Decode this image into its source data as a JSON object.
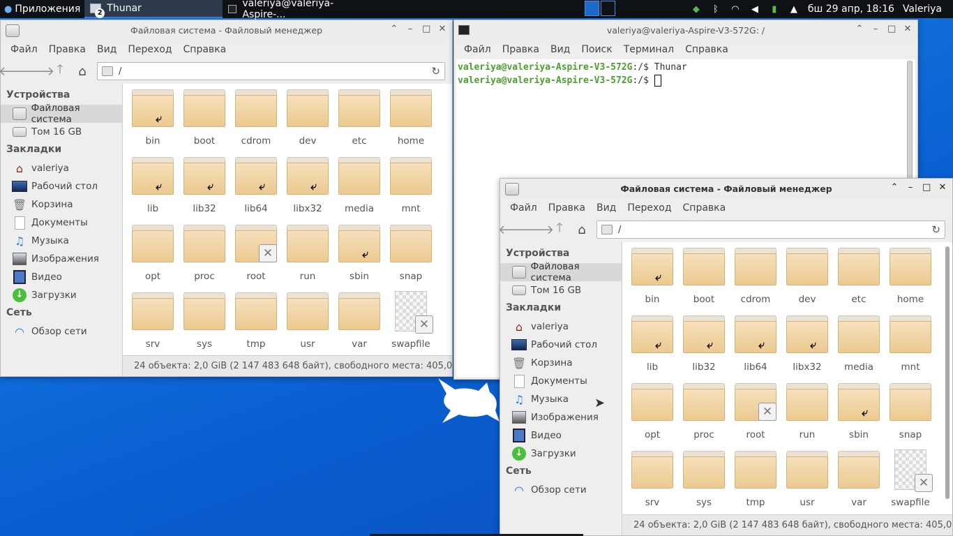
{
  "panel": {
    "apps_label": "Приложения",
    "tasks": [
      {
        "label": "Thunar",
        "badge": "2"
      },
      {
        "label": "valeriya@valeriya-Aspire-..."
      }
    ],
    "clock": "бш 29 апр, 18:16",
    "user": "Valeriya"
  },
  "fm_title": "Файловая система - Файловый менеджер",
  "fm_menu": [
    "Файл",
    "Правка",
    "Вид",
    "Переход",
    "Справка"
  ],
  "location": "/",
  "sidebar": {
    "devices_header": "Устройства",
    "devices": [
      {
        "label": "Файловая система",
        "icon": "disk-icon"
      },
      {
        "label": "Том 16 GB",
        "icon": "drive-icon"
      }
    ],
    "bookmarks_header": "Закладки",
    "bookmarks": [
      {
        "label": "valeriya",
        "icon": "home-icon"
      },
      {
        "label": "Рабочий стол",
        "icon": "desktop-icon"
      },
      {
        "label": "Корзина",
        "icon": "trash-icon"
      },
      {
        "label": "Документы",
        "icon": "document-icon"
      },
      {
        "label": "Музыка",
        "icon": "music-icon"
      },
      {
        "label": "Изображения",
        "icon": "pictures-icon"
      },
      {
        "label": "Видео",
        "icon": "video-icon"
      },
      {
        "label": "Загрузки",
        "icon": "download-icon"
      }
    ],
    "network_header": "Сеть",
    "network": [
      {
        "label": "Обзор сети",
        "icon": "network-icon"
      }
    ]
  },
  "files": [
    "bin",
    "boot",
    "cdrom",
    "dev",
    "etc",
    "home",
    "lib",
    "lib32",
    "lib64",
    "libx32",
    "media",
    "mnt",
    "opt",
    "proc",
    "root",
    "run",
    "sbin",
    "snap",
    "srv",
    "sys",
    "tmp",
    "usr",
    "var",
    "swapfile"
  ],
  "status": "24 объекта: 2,0 GiB (2 147 483 648 байт), свободного места: 405,0 ...",
  "terminal": {
    "title": "valeriya@valeriya-Aspire-V3-572G: /",
    "menu": [
      "Файл",
      "Правка",
      "Вид",
      "Поиск",
      "Терминал",
      "Справка"
    ],
    "prompt": "valeriya@valeriya-Aspire-V3-572G",
    "line1_rest": ":/$ Thunar",
    "line2_rest": ":/$ "
  },
  "colors": {
    "desktop": "#0a5fd0",
    "prompt_green": "#4aa02c",
    "folder": "#ecc990"
  }
}
